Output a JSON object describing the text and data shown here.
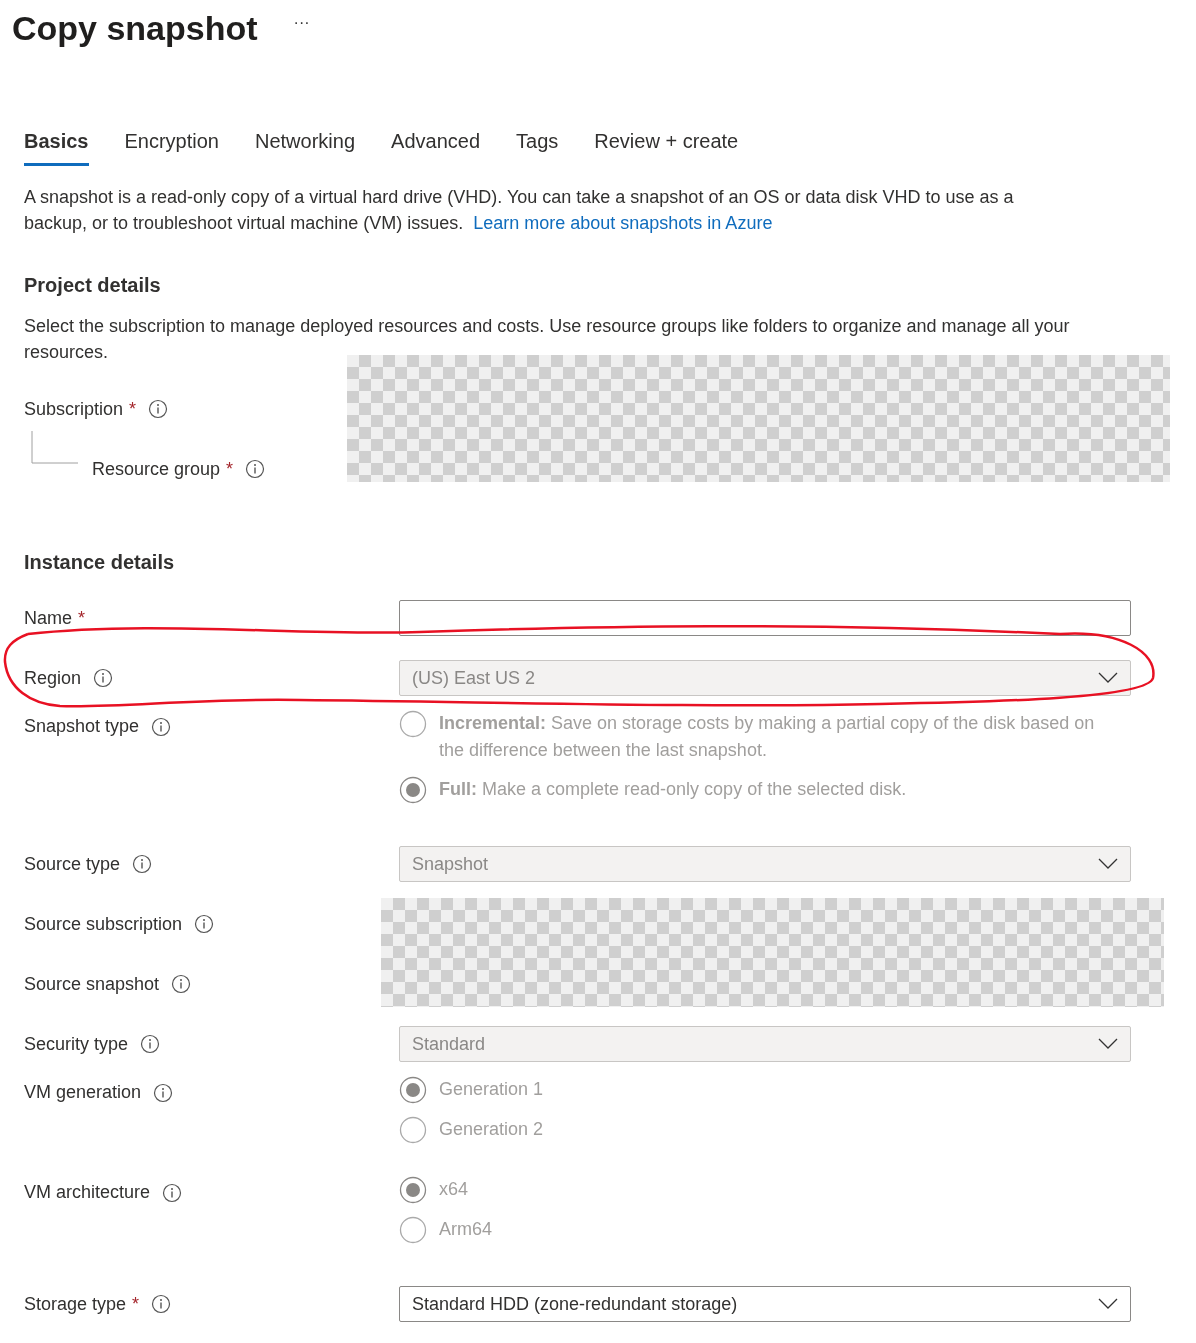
{
  "title": "Copy snapshot",
  "more": "···",
  "tabs": [
    {
      "label": "Basics",
      "selected": true
    },
    {
      "label": "Encryption",
      "selected": false
    },
    {
      "label": "Networking",
      "selected": false
    },
    {
      "label": "Advanced",
      "selected": false
    },
    {
      "label": "Tags",
      "selected": false
    },
    {
      "label": "Review + create",
      "selected": false
    }
  ],
  "intro": {
    "text": "A snapshot is a read-only copy of a virtual hard drive (VHD). You can take a snapshot of an OS or data disk VHD to use as a backup, or to troubleshoot virtual machine (VM) issues.",
    "link": "Learn more about snapshots in Azure"
  },
  "sections": [
    {
      "heading": "Project details",
      "description": "Select the subscription to manage deployed resources and costs. Use resource groups like folders to organize and manage all your resources.",
      "items": [
        {
          "kind": "redacted",
          "rows": [
            {
              "label": "Subscription",
              "required": "*",
              "info": true,
              "children": [
                {
                  "label": "Resource group",
                  "required": "*",
                  "info": true
                }
              ]
            }
          ]
        }
      ]
    },
    {
      "heading": "Instance details",
      "items": [
        {
          "kind": "text",
          "label": "Name",
          "required": "*",
          "info": false
        },
        {
          "kind": "dropdown",
          "label": "Region",
          "info": true,
          "value": "(US) East US 2",
          "disabled": true
        },
        {
          "kind": "radio",
          "label": "Snapshot type",
          "info": true,
          "disabled": true,
          "options": [
            {
              "text": "**Incremental:** Save on storage costs by making a partial copy of the disk based on the difference between the last snapshot.",
              "selected": false
            },
            {
              "text": "**Full:** Make a complete read-only copy of the selected disk.",
              "selected": true
            }
          ]
        },
        {
          "kind": "dropdown",
          "label": "Source type",
          "info": true,
          "value": "Snapshot",
          "disabled": true
        },
        {
          "kind": "redacted",
          "rows": [
            {
              "label": "Source subscription",
              "info": true
            },
            {
              "label": "Source snapshot",
              "info": true
            }
          ]
        },
        {
          "kind": "dropdown",
          "label": "Security type",
          "info": true,
          "value": "Standard",
          "disabled": true
        },
        {
          "kind": "radio",
          "label": "VM generation",
          "info": true,
          "disabled": true,
          "options": [
            {
              "text": "Generation 1",
              "selected": true
            },
            {
              "text": "Generation 2",
              "selected": false
            }
          ]
        },
        {
          "kind": "radio",
          "label": "VM architecture",
          "info": true,
          "disabled": true,
          "options": [
            {
              "text": "x64",
              "selected": true
            },
            {
              "text": "Arm64",
              "selected": false
            }
          ]
        },
        {
          "kind": "dropdown",
          "label": "Storage type",
          "required": "*",
          "info": true,
          "value": "Standard HDD (zone-redundant storage)",
          "disabled": false
        }
      ]
    }
  ],
  "annotations": [
    {
      "kind": "freehand-ellipse"
    }
  ]
}
